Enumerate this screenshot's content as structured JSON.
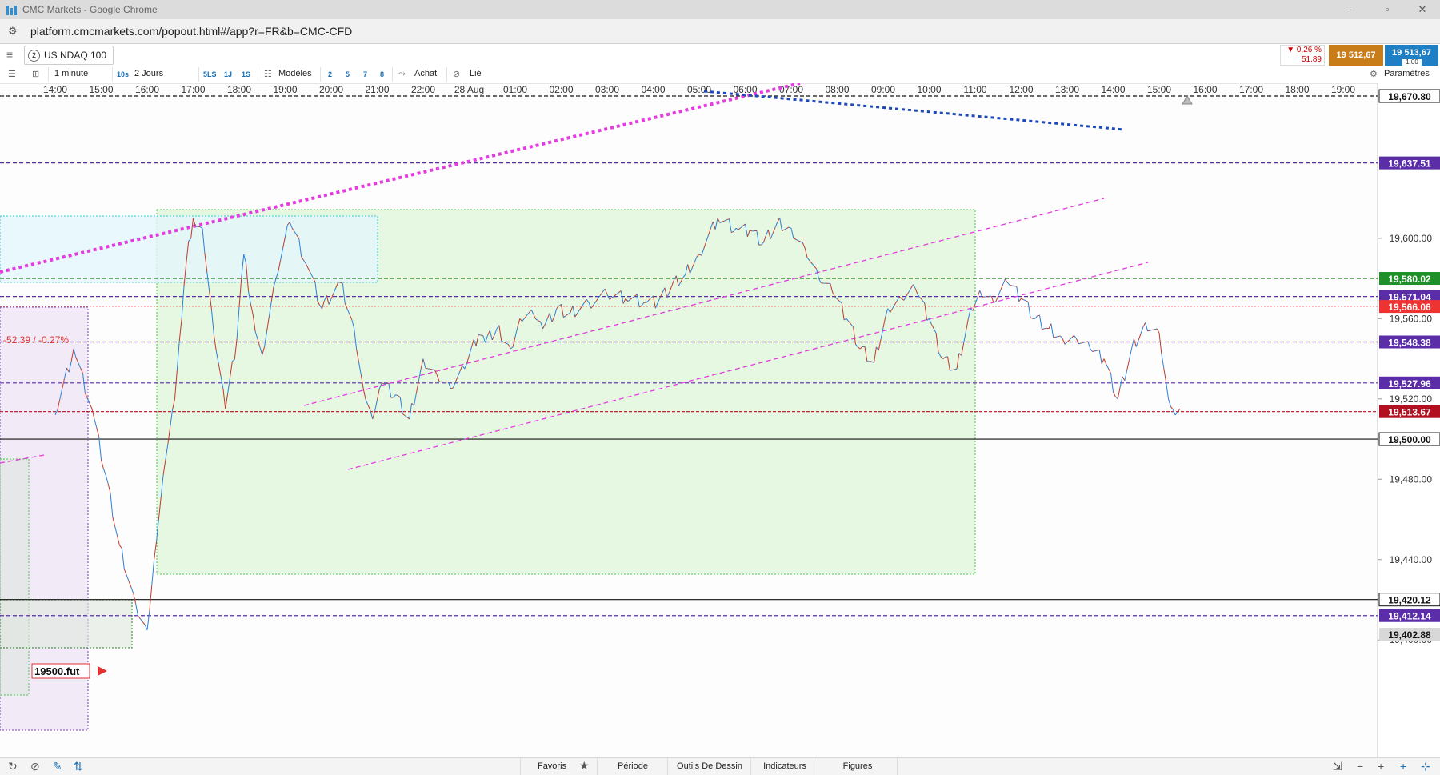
{
  "window": {
    "title": "CMC Markets - Google Chrome",
    "url": "platform.cmcmarkets.com/popout.html#/app?r=FR&b=CMC-CFD",
    "controls": [
      "–",
      "▫",
      "✕"
    ]
  },
  "instrument": {
    "number": "2",
    "name": "US NDAQ 100",
    "change_pct": "▼ 0,26 %",
    "change_pts": "51.89",
    "sell_price": "19 512,67",
    "buy_price": "19 513,67",
    "spread": "1.00"
  },
  "toolbar": {
    "interval": "1 minute",
    "interval_short": "10s",
    "period": "2 Jours",
    "quick_periods": [
      "5LS",
      "1J",
      "1S"
    ],
    "templates": "Modèles",
    "presets": [
      "2",
      "5",
      "7",
      "8"
    ],
    "buy": "Achat",
    "linked": "Lié",
    "settings": "Paramètres"
  },
  "chart_data": {
    "type": "line",
    "instrument": "US NDAQ 100",
    "x_ticks": [
      "14:00",
      "15:00",
      "16:00",
      "17:00",
      "18:00",
      "19:00",
      "20:00",
      "21:00",
      "22:00",
      "28 Aug",
      "01:00",
      "02:00",
      "03:00",
      "04:00",
      "05:00",
      "06:00",
      "07:00",
      "08:00",
      "09:00",
      "10:00",
      "11:00",
      "12:00",
      "13:00",
      "14:00",
      "15:00",
      "16:00",
      "17:00",
      "18:00",
      "19:00"
    ],
    "y_ticks": [
      "19,600.00",
      "19,560.00",
      "19,520.00",
      "19,480.00",
      "19,440.00",
      "19,400.00"
    ],
    "ylim": [
      19398,
      19675
    ],
    "price_tags": [
      {
        "label": "19,670.80",
        "value": 19670.8,
        "style": "black-dash"
      },
      {
        "label": "19,637.51",
        "value": 19637.51,
        "style": "purple"
      },
      {
        "label": "19,580.02",
        "value": 19580.02,
        "style": "green"
      },
      {
        "label": "19,571.04",
        "value": 19571.04,
        "style": "purple"
      },
      {
        "label": "19,566.06",
        "value": 19566.06,
        "style": "red"
      },
      {
        "label": "19,548.38",
        "value": 19548.38,
        "style": "purple"
      },
      {
        "label": "19,527.96",
        "value": 19527.96,
        "style": "purple"
      },
      {
        "label": "19,513.67",
        "value": 19513.67,
        "style": "darkred"
      },
      {
        "label": "19,500.00",
        "value": 19500.0,
        "style": "black"
      },
      {
        "label": "19,420.12",
        "value": 19420.12,
        "style": "black"
      },
      {
        "label": "19,412.14",
        "value": 19412.14,
        "style": "purple"
      },
      {
        "label": "19,402.88",
        "value": 19402.88,
        "style": "gray"
      }
    ],
    "annotations": {
      "change": "-52.39 / -0.27%",
      "note": "19500.fut"
    },
    "series": [
      {
        "x": [
          0,
          0.4,
          0.8,
          1.1,
          1.4,
          1.75,
          2.0,
          2.15,
          2.4,
          2.6,
          2.75,
          2.85,
          3.0,
          3.2,
          3.45,
          3.7,
          3.95,
          4.1,
          4.3,
          4.5,
          4.8,
          5.1,
          5.5,
          5.8,
          6.2,
          6.5,
          6.7,
          6.9,
          7.1,
          7.4,
          7.7,
          8.0,
          8.3,
          8.6,
          8.9,
          9.2,
          9.35,
          9.6,
          9.9,
          10.1,
          10.4,
          10.6,
          10.9,
          11.2,
          11.6,
          12.0,
          12.4,
          12.8,
          13.1,
          13.4,
          13.7,
          14.0,
          14.4,
          14.8,
          15.1,
          15.4,
          15.7,
          16.0,
          16.3,
          16.6,
          16.9,
          17.2,
          17.5,
          17.8,
          18.1,
          18.4,
          18.7,
          19.0,
          19.3,
          19.6,
          19.9,
          20.1,
          20.4,
          20.7,
          21.0,
          21.3,
          21.6,
          21.9,
          22.2,
          22.5,
          22.8,
          23.1,
          23.4,
          23.7,
          24.0,
          24.2,
          24.35,
          24.45
        ],
        "y": [
          19512,
          19545,
          19515,
          19482,
          19447,
          19418,
          19405,
          19440,
          19490,
          19520,
          19560,
          19588,
          19610,
          19605,
          19552,
          19515,
          19550,
          19592,
          19562,
          19542,
          19580,
          19608,
          19585,
          19565,
          19578,
          19555,
          19525,
          19510,
          19528,
          19522,
          19510,
          19540,
          19532,
          19525,
          19535,
          19552,
          19548,
          19555,
          19545,
          19560,
          19562,
          19555,
          19565,
          19563,
          19568,
          19572,
          19570,
          19568,
          19568,
          19576,
          19582,
          19592,
          19610,
          19605,
          19604,
          19598,
          19608,
          19605,
          19595,
          19580,
          19573,
          19560,
          19545,
          19538,
          19565,
          19570,
          19575,
          19560,
          19540,
          19535,
          19565,
          19574,
          19568,
          19578,
          19570,
          19560,
          19555,
          19550,
          19550,
          19545,
          19540,
          19520,
          19545,
          19558,
          19553,
          19520,
          19512,
          19515
        ]
      }
    ]
  },
  "bottom": {
    "tabs": [
      "Favoris",
      "Période",
      "Outils De Dessin",
      "Indicateurs",
      "Figures"
    ]
  },
  "colors": {
    "up": "#2b7fd8",
    "down": "#c0392b",
    "purple_line": "#5b2da7",
    "green_line": "#1a7f1a",
    "magenta": "#e43ce0",
    "zone_green": "#e6f8e2",
    "zone_cyan": "#e4f6fb"
  }
}
